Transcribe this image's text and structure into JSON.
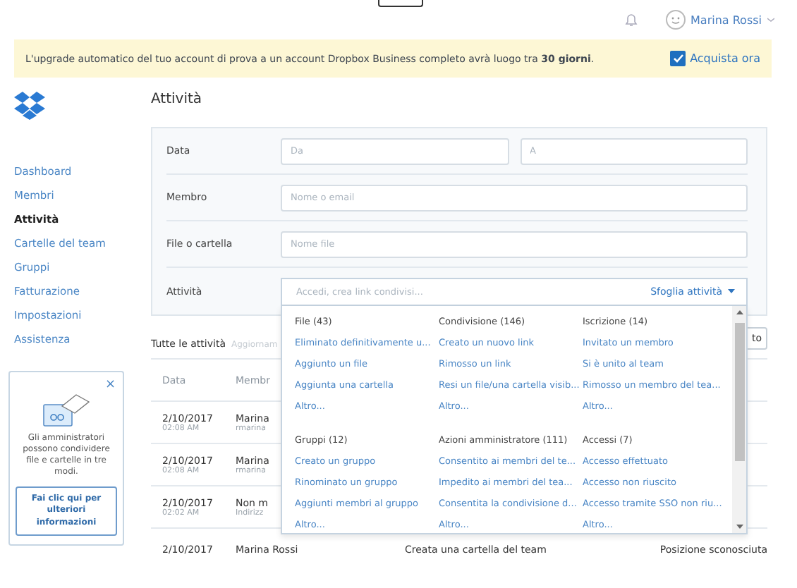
{
  "topbar": {
    "user_name": "Marina Rossi"
  },
  "banner": {
    "text": "L'upgrade automatico del tuo account di prova a un account Dropbox Business completo avrà luogo tra **30 giorni**.",
    "action": "Acquista ora",
    "checked": true
  },
  "sidebar": {
    "items": [
      {
        "label": "Dashboard",
        "selected": false
      },
      {
        "label": "Membri",
        "selected": false
      },
      {
        "label": "Attività",
        "selected": true
      },
      {
        "label": "Cartelle del team",
        "selected": false
      },
      {
        "label": "Gruppi",
        "selected": false
      },
      {
        "label": "Fatturazione",
        "selected": false
      },
      {
        "label": "Impostazioni",
        "selected": false
      },
      {
        "label": "Assistenza",
        "selected": false
      }
    ]
  },
  "promo": {
    "close": "×",
    "text": "Gli amministratori possono condividere file e cartelle in tre modi.",
    "button": "Fai clic qui per ulteriori informazioni"
  },
  "page_title": "Attività",
  "filters": {
    "date_label": "Data",
    "from_placeholder": "Da",
    "to_placeholder": "A",
    "member_label": "Membro",
    "member_placeholder": "Nome o email",
    "file_label": "File o cartella",
    "file_placeholder": "Nome file",
    "activity_label": "Attività",
    "activity_placeholder": "Accedi, crea link condivisi...",
    "browse": "Sfoglia attività"
  },
  "activity_menu": {
    "groups": [
      {
        "title": "File (43)",
        "items": [
          "Eliminato definitivamente u...",
          "Aggiunto un file",
          "Aggiunta una cartella",
          "Altro..."
        ]
      },
      {
        "title": "Condivisione (146)",
        "items": [
          "Creato un nuovo link",
          "Rimosso un link",
          "Resi un file/una cartella visib...",
          "Altro..."
        ]
      },
      {
        "title": "Iscrizione (14)",
        "items": [
          "Invitato un membro",
          "Si è unito al team",
          "Rimosso un membro del tea...",
          "Altro..."
        ]
      },
      {
        "title": "Gruppi (12)",
        "items": [
          "Creato un gruppo",
          "Rinominato un gruppo",
          "Aggiunti membri al gruppo",
          "Altro..."
        ]
      },
      {
        "title": "Azioni amministratore (111)",
        "items": [
          "Consentito ai membri del te...",
          "Impedito ai membri del tea...",
          "Consentita la condivisione d...",
          "Altro..."
        ]
      },
      {
        "title": "Accessi (7)",
        "items": [
          "Accesso effettuato",
          "Accesso non riuscito",
          "Accesso tramite SSO non riu...",
          "Altro..."
        ]
      }
    ]
  },
  "results": {
    "title": "Tutte le attività",
    "subtitle": "Aggiornam",
    "button": "to"
  },
  "table": {
    "columns": [
      "Data",
      "Membr"
    ],
    "rows": [
      {
        "date": "2/10/2017",
        "time": "02:08 AM",
        "member": "Marina",
        "member_sub": "rmarina"
      },
      {
        "date": "2/10/2017",
        "time": "02:08 AM",
        "member": "Marina",
        "member_sub": "rmarina"
      },
      {
        "date": "2/10/2017",
        "time": "02:02 AM",
        "member": "Non m",
        "member_sub": "Indirizz"
      },
      {
        "date": "2/10/2017",
        "member": "Marina Rossi",
        "event": "Creata una cartella del team",
        "location": "Posizione sconosciuta"
      }
    ]
  }
}
